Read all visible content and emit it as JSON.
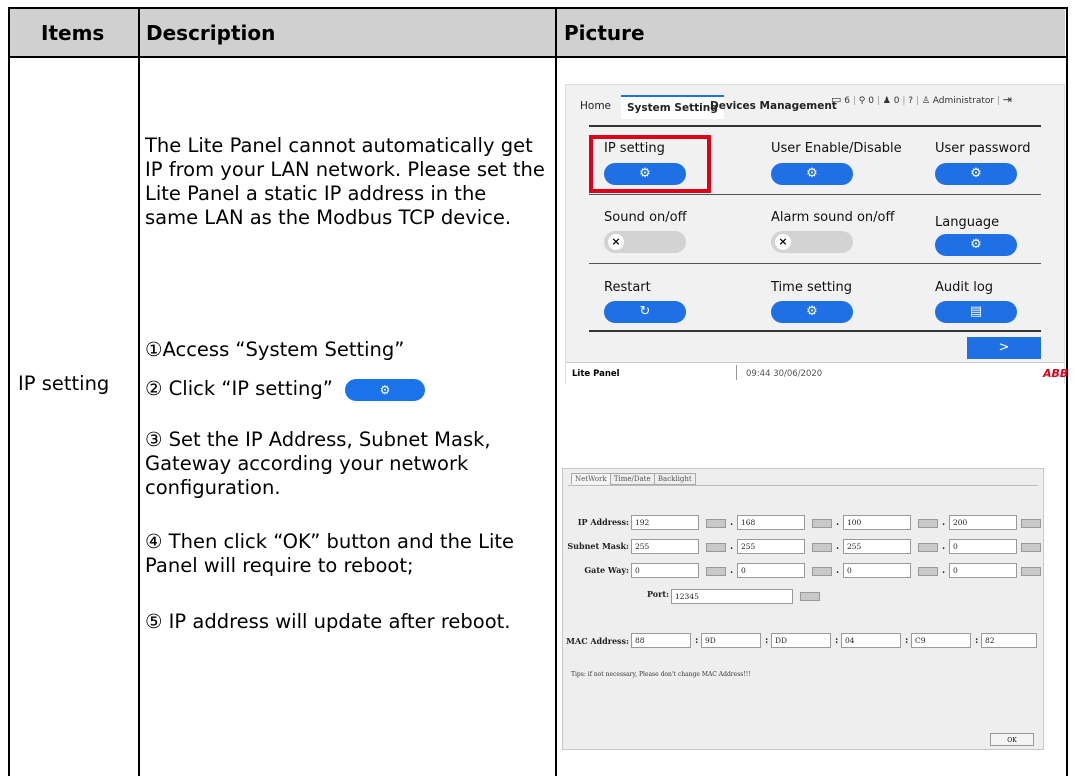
{
  "table": {
    "headers": {
      "items": "Items",
      "description": "Description",
      "picture": "Picture"
    },
    "row_item": "IP setting"
  },
  "description": {
    "intro": "The Lite Panel cannot automatically get IP from your LAN network. Please set the Lite Panel a static IP address in the same LAN as the Modbus TCP device.",
    "step1": "①Access “System Setting”",
    "step2": "② Click “IP setting”",
    "step3": "③ Set the IP Address, Subnet Mask, Gateway according your network configuration.",
    "step4": "④ Then click “OK” button and the Lite Panel will require to reboot;",
    "step5": "⑤ IP address will update after reboot."
  },
  "panel1": {
    "tabs": {
      "home": "Home",
      "system": "System Setting",
      "devices": "Devices Management"
    },
    "status": {
      "monitor_count": "6",
      "plug_count": "0",
      "bell_count": "0",
      "user": "Administrator"
    },
    "labels": {
      "ip_setting": "IP setting",
      "user_enable": "User Enable/Disable",
      "user_password": "User password",
      "sound": "Sound on/off",
      "alarm_sound": "Alarm sound on/off",
      "language": "Language",
      "restart": "Restart",
      "time_setting": "Time setting",
      "audit_log": "Audit log"
    },
    "toggle_mark": "×",
    "next": ">",
    "footer": {
      "device": "Lite Panel",
      "datetime": "09:44 30/06/2020",
      "brand": "ABB"
    },
    "highlight_color": "#e0001a"
  },
  "panel2": {
    "tabs": {
      "network": "NetWork",
      "timedate": "Time/Date",
      "backlight": "Backlight"
    },
    "labels": {
      "ip": "IP Address:",
      "subnet": "Subnet Mask:",
      "gateway": "Gate Way:",
      "port": "Port:",
      "mac": "MAC Address:"
    },
    "ip": [
      "192",
      "168",
      "100",
      "200"
    ],
    "subnet": [
      "255",
      "255",
      "255",
      "0"
    ],
    "gateway": [
      "0",
      "0",
      "0",
      "0"
    ],
    "port": "12345",
    "mac": [
      "88",
      "9D",
      "DD",
      "04",
      "C9",
      "82"
    ],
    "tip": "Tips: if not necessary, Please don't change MAC Address!!!",
    "ok": "OK"
  }
}
